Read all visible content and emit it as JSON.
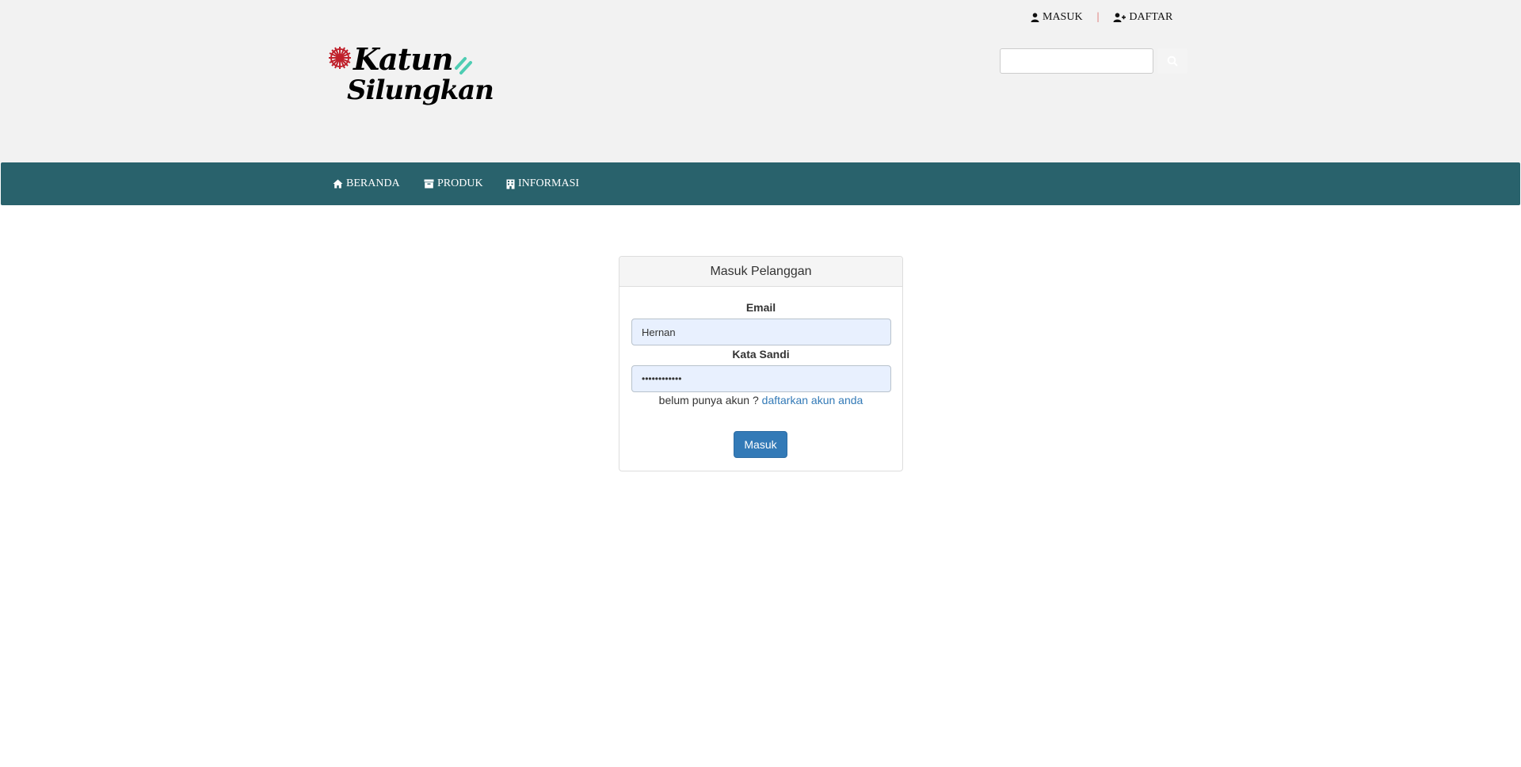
{
  "header": {
    "login_link": "MASUK",
    "separator": "|",
    "register_link": "DAFTAR",
    "logo_line1": "Katun",
    "logo_line2": "Silungkan",
    "search": {
      "value": "",
      "placeholder": ""
    }
  },
  "nav": {
    "items": [
      {
        "label": "BERANDA",
        "icon": "home-icon"
      },
      {
        "label": "PRODUK",
        "icon": "archive-icon"
      },
      {
        "label": "INFORMASI",
        "icon": "building-icon"
      }
    ]
  },
  "login": {
    "title": "Masuk Pelanggan",
    "email_label": "Email",
    "email_value": "Hernan",
    "password_label": "Kata Sandi",
    "password_value": "••••••••••••",
    "register_prompt": "belum punya akun ?",
    "register_link": "daftarkan akun anda",
    "submit_label": "Masuk"
  },
  "colors": {
    "nav_bg": "#29626c",
    "topbar_bg": "#f2f2f2",
    "primary": "#337ab7",
    "separator": "#d9534f",
    "logo_accent": "#4ecdb3",
    "logo_flower": "#c0202b"
  }
}
